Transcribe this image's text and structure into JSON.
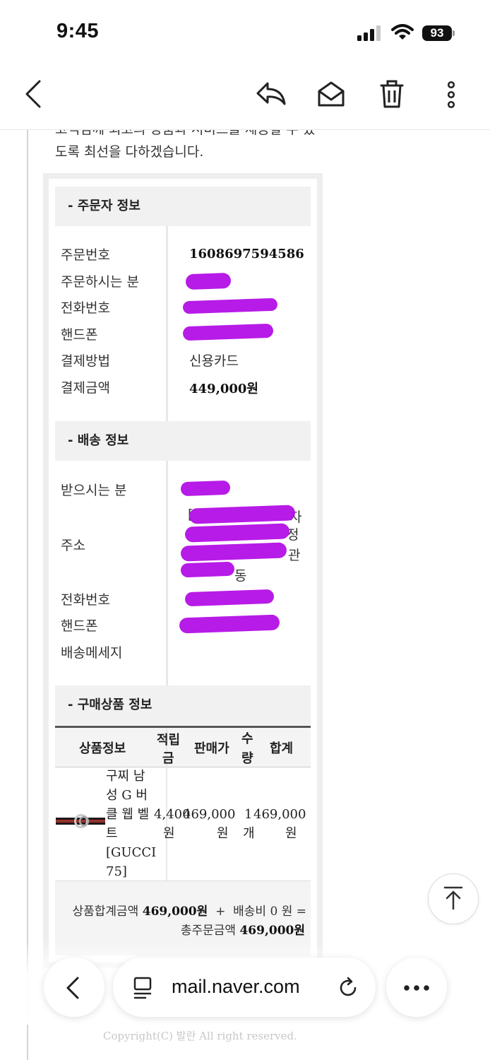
{
  "status_bar": {
    "time": "9:45",
    "battery": "93"
  },
  "mail": {
    "intro_partial": "고객님께 최고의 상품과 서비스를 제공할 수 있",
    "intro_line2": "도록 최선을 다하겠습니다.",
    "orderer": {
      "title": "- 주문자 정보",
      "order_no_label": "주문번호",
      "order_no": "1608697594586",
      "name_label": "주문하시는 분",
      "phone_label": "전화번호",
      "mobile_label": "핸드폰",
      "payment_label": "결제방법",
      "payment": "신용카드",
      "amount_label": "결제금액",
      "amount": "449,000원"
    },
    "shipping": {
      "title": "- 배송 정보",
      "recipient_label": "받으시는 분",
      "address_label": "주소",
      "address_fragments": [
        "[",
        "자",
        "정",
        "관",
        "동"
      ],
      "phone_label": "전화번호",
      "mobile_label": "핸드폰",
      "message_label": "배송메세지"
    },
    "products": {
      "title": "- 구매상품 정보",
      "headers": {
        "info": "상품정보",
        "points_1": "적립",
        "points_2": "금",
        "price": "판매가",
        "qty_1": "수",
        "qty_2": "량",
        "total": "합계"
      },
      "rows": [
        {
          "name_lines": [
            "구찌 남",
            "성 G 버",
            "클 웹 벨",
            "트",
            "[GUCCI",
            "75]"
          ],
          "points": "4,400",
          "points_unit": "원",
          "price": "469,000",
          "price_unit": "원",
          "qty": "1",
          "qty_unit": "개",
          "total": "469,000",
          "total_unit": "원"
        }
      ],
      "summary": {
        "subtotal_label": "상품합계금액",
        "subtotal": "469,000원",
        "plus": "+",
        "shipping_label": "배송비",
        "shipping": "0 원",
        "equals": "=",
        "grand_label": "총주문금액",
        "grand": "469,000원"
      }
    },
    "copyright": "Copyright(C) 발란 All right reserved."
  },
  "browser": {
    "url": "mail.naver.com"
  },
  "colors": {
    "redaction": "#b30fe6",
    "section_bg": "#f1f1f1"
  }
}
